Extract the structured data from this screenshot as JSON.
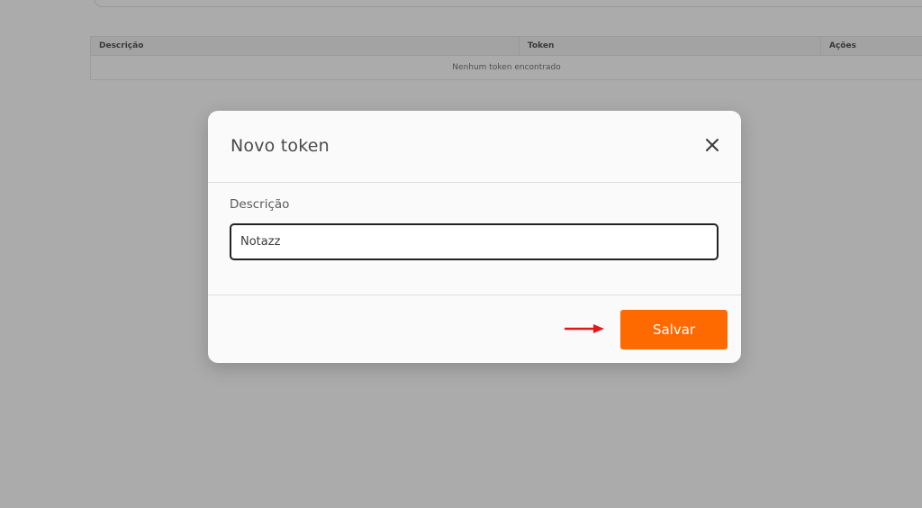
{
  "table": {
    "headers": [
      "Descrição",
      "Token",
      "Ações"
    ],
    "empty_message": "Nenhum token encontrado"
  },
  "modal": {
    "title": "Novo token",
    "field_label": "Descrição",
    "description_value": "Notazz",
    "save_label": "Salvar"
  },
  "icons": {
    "close": "close-icon",
    "arrow": "arrow-right-icon"
  },
  "colors": {
    "accent": "#ff6a00",
    "annotation": "#e8141b"
  }
}
